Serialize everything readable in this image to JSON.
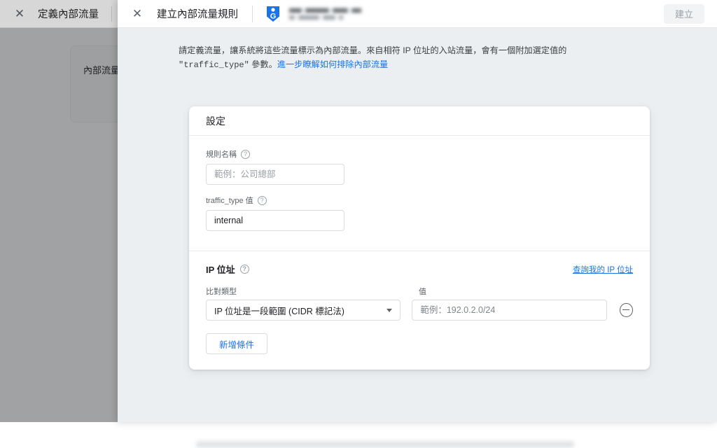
{
  "background_page": {
    "close_icon": "close-icon",
    "title": "定義內部流量",
    "card_text": "內部流量規"
  },
  "modal": {
    "close_icon": "close-icon",
    "title": "建立內部流量規則",
    "logo_icon": "google-analytics-tag-icon",
    "account_name_redacted": "",
    "create_button": "建立",
    "intro": {
      "part1": "請定義流量，讓系統將這些流量標示為內部流量。來自相符 IP 位址的入站流量，會有一個附加選定值的 ",
      "code": "\"traffic_type\"",
      "part2": " 參數。",
      "link": "進一步瞭解如何排除內部流量"
    },
    "card": {
      "header": "設定",
      "rule_name": {
        "label": "規則名稱",
        "help_icon": "help-circle-icon",
        "value": "",
        "placeholder": "範例：公司總部"
      },
      "traffic_type": {
        "label": "traffic_type 值",
        "help_icon": "help-circle-icon",
        "value": "internal",
        "placeholder": ""
      },
      "ip_section": {
        "heading": "IP 位址",
        "help_icon": "help-circle-icon",
        "lookup_link": "查詢我的 IP 位址",
        "column_match_type": "比對類型",
        "column_value": "值",
        "match_type_selected": "IP 位址是一段範圍 (CIDR 標記法)",
        "caret_icon": "chevron-down-icon",
        "value_input": "",
        "value_placeholder": "範例：192.0.2.0/24",
        "remove_icon": "remove-circle-icon",
        "add_condition_button": "新增條件"
      }
    }
  },
  "colors": {
    "accent": "#1a73e8",
    "panel_bg": "#eceff1",
    "card_bg": "#ffffff",
    "border": "#dadce0",
    "text_primary": "#202124",
    "text_secondary": "#5f6368"
  }
}
